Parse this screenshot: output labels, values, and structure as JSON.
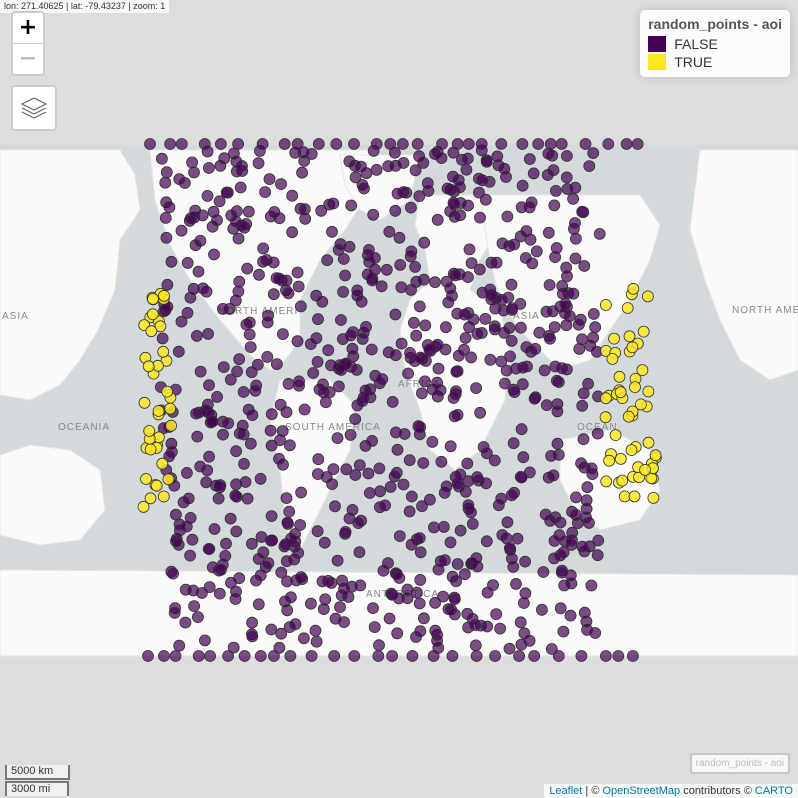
{
  "status_bar": {
    "text": "lon: 271.40625 | lat: -79.43237 | zoom: 1"
  },
  "zoom": {
    "in_label": "+",
    "out_label": "−"
  },
  "legend": {
    "title": "random_points - aoi",
    "items": [
      {
        "label": "FALSE",
        "color": "#440154"
      },
      {
        "label": "TRUE",
        "color": "#FDE725"
      }
    ]
  },
  "layer_toggle": {
    "label": "random_points - aoi"
  },
  "scale": {
    "km": "5000 km",
    "mi": "3000 mi"
  },
  "attribution": {
    "leaflet": "Leaflet",
    "sep": " | © ",
    "osm": "OpenStreetMap",
    "contrib": " contributors © ",
    "carto": "CARTO"
  },
  "map_labels": {
    "asia_left": "ASIA",
    "north_america": "NORTH AMERICA",
    "north_america_frag": "NORTH AMERI",
    "oceania": "OCEANIA",
    "south_america": "SOUTH AMERICA",
    "antarctica": "ANTARCTICA",
    "asia_frag": "ASIA",
    "oceania_frag": "OCEAN",
    "africa_frag": "AFRICA"
  },
  "icons": [
    "zoom-in-icon",
    "zoom-out-icon",
    "layers-icon"
  ],
  "colors": {
    "water": "#d4dadc",
    "land": "#fafaf8",
    "outside": "#dddddd",
    "point_false": "#440154",
    "point_true": "#FDE725"
  }
}
